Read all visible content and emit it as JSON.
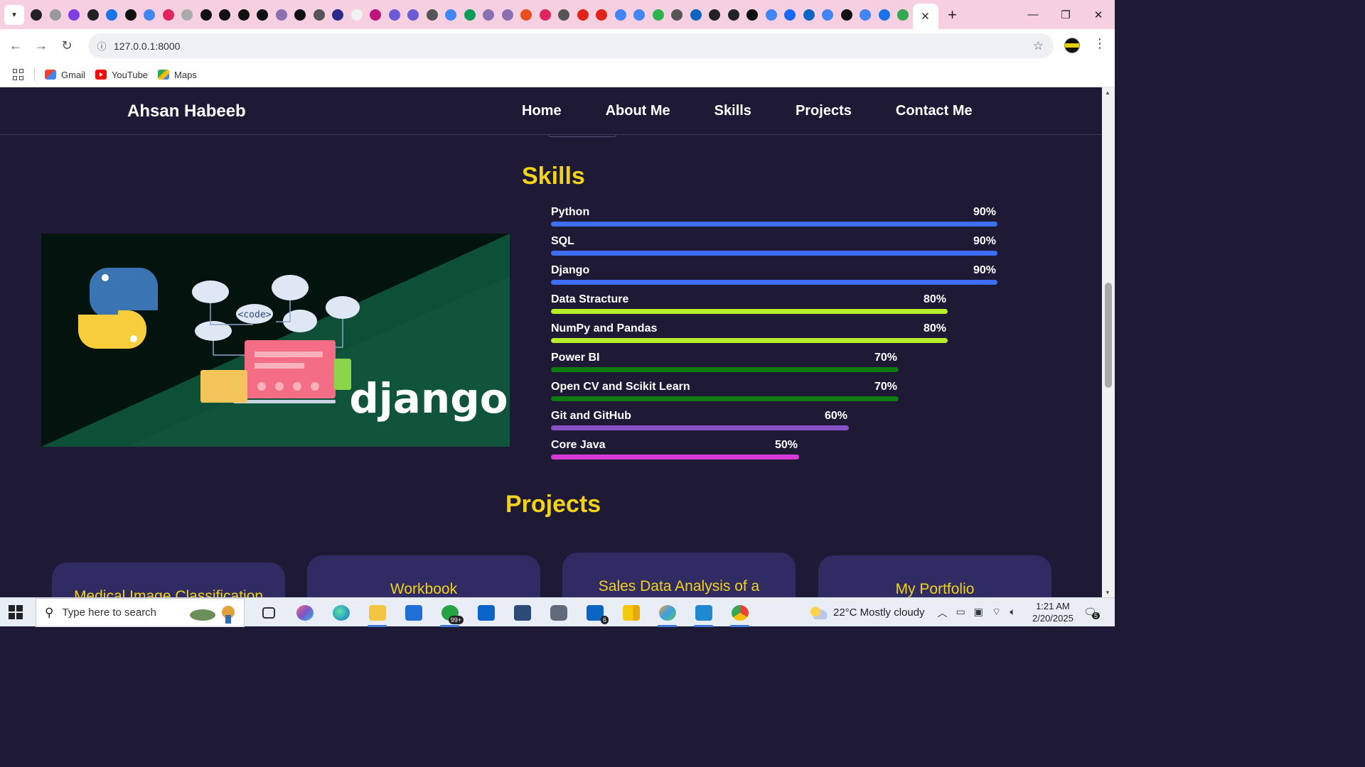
{
  "browser": {
    "url": "127.0.0.1:8000",
    "active_tab_close": "✕",
    "new_tab": "+",
    "window_controls": [
      "—",
      "❐",
      "✕"
    ],
    "bookmarks": [
      {
        "label": "Gmail",
        "icon": "gmail-icon"
      },
      {
        "label": "YouTube",
        "icon": "youtube-icon"
      },
      {
        "label": "Maps",
        "icon": "maps-icon"
      }
    ],
    "tab_favicon_colors": [
      "#222",
      "#999",
      "#7b3fe4",
      "#222",
      "#1a73e8",
      "#111",
      "#4285f4",
      "#e0245e",
      "#aaa",
      "#111",
      "#111",
      "#111",
      "#111",
      "#8a6fb3",
      "#111",
      "#555",
      "#2b2a8c",
      "#f2f2f2",
      "#c0147b",
      "#6b5bd6",
      "#6b5bd6",
      "#555",
      "#4285f4",
      "#0a9d58",
      "#8a6fb3",
      "#8a6fb3",
      "#e94e1b",
      "#e0245e",
      "#555",
      "#e2231a",
      "#e2231a",
      "#4285f4",
      "#4285f4",
      "#2bb34f",
      "#555",
      "#0a66c2",
      "#222",
      "#222",
      "#111",
      "#4285f4",
      "#1769ff",
      "#0a66c2",
      "#4285f4",
      "#111",
      "#4285f4",
      "#1a73e8",
      "#34a853"
    ]
  },
  "site": {
    "brand": "Ahsan Habeeb",
    "nav": [
      "Home",
      "About Me",
      "Skills",
      "Projects",
      "Contact Me"
    ],
    "skills_title": "Skills",
    "skills": [
      {
        "name": "Python",
        "percent": "90%",
        "level": 90,
        "color": "#3d6ef5"
      },
      {
        "name": "SQL",
        "percent": "90%",
        "level": 90,
        "color": "#3d6ef5"
      },
      {
        "name": "Django",
        "percent": "90%",
        "level": 90,
        "color": "#3d6ef5"
      },
      {
        "name": "Data Stracture",
        "percent": "80%",
        "level": 80,
        "color": "#b6ef2a"
      },
      {
        "name": "NumPy and Pandas",
        "percent": "80%",
        "level": 80,
        "color": "#b6ef2a"
      },
      {
        "name": "Power BI",
        "percent": "70%",
        "level": 70,
        "color": "#0f7a0f"
      },
      {
        "name": "Open CV and Scikit Learn",
        "percent": "70%",
        "level": 70,
        "color": "#0f7a0f"
      },
      {
        "name": "Git and GitHub",
        "percent": "60%",
        "level": 60,
        "color": "#8a52c9"
      },
      {
        "name": "Core Java",
        "percent": "50%",
        "level": 50,
        "color": "#d83ad8"
      }
    ],
    "hero_image_text": "django",
    "hero_image_code_tag": "<code>",
    "projects_title": "Projects",
    "project_cards": [
      "Medical Image Classification",
      "Workbook",
      "Sales Data Analysis of a",
      "My Portfolio"
    ]
  },
  "taskbar": {
    "search_placeholder": "Type here to search",
    "whatsapp_badge": "99+",
    "linkedin_badge": "6",
    "weather": "22°C  Mostly cloudy",
    "time": "1:21 AM",
    "date": "2/20/2025",
    "notifications": "5"
  }
}
